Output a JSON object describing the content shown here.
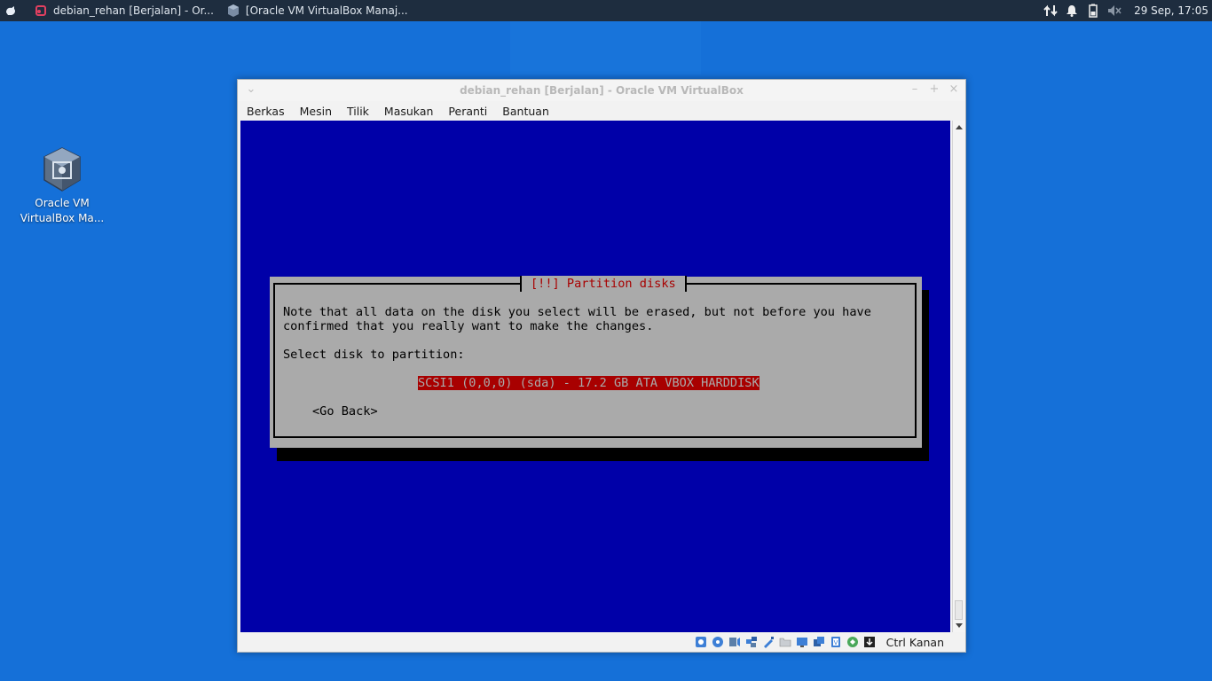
{
  "panel": {
    "tasks": [
      {
        "label": "debian_rehan [Berjalan] - Or...",
        "icon": "virtualbox-vm-icon"
      },
      {
        "label": "[Oracle VM VirtualBox Manaj...",
        "icon": "virtualbox-manager-icon"
      }
    ],
    "clock": "29 Sep, 17:05"
  },
  "desktop": {
    "icon_label_1": "Oracle VM",
    "icon_label_2": "VirtualBox Ma..."
  },
  "window": {
    "title": "debian_rehan [Berjalan] - Oracle VM VirtualBox",
    "menu": [
      "Berkas",
      "Mesin",
      "Tilik",
      "Masukan",
      "Peranti",
      "Bantuan"
    ],
    "host_key": "Ctrl Kanan"
  },
  "installer": {
    "title": "[!!] Partition disks",
    "line1": "Note that all data on the disk you select will be erased, but not before you have",
    "line2": "confirmed that you really want to make the changes.",
    "prompt": "Select disk to partition:",
    "selected_disk": "SCSI1 (0,0,0) (sda) - 17.2 GB ATA VBOX HARDDISK",
    "go_back": "<Go Back>"
  },
  "colors": {
    "desktop": "#1570d8",
    "vm_background": "#0000a8",
    "dialog": "#aaaaaa",
    "highlight": "#a80000"
  }
}
